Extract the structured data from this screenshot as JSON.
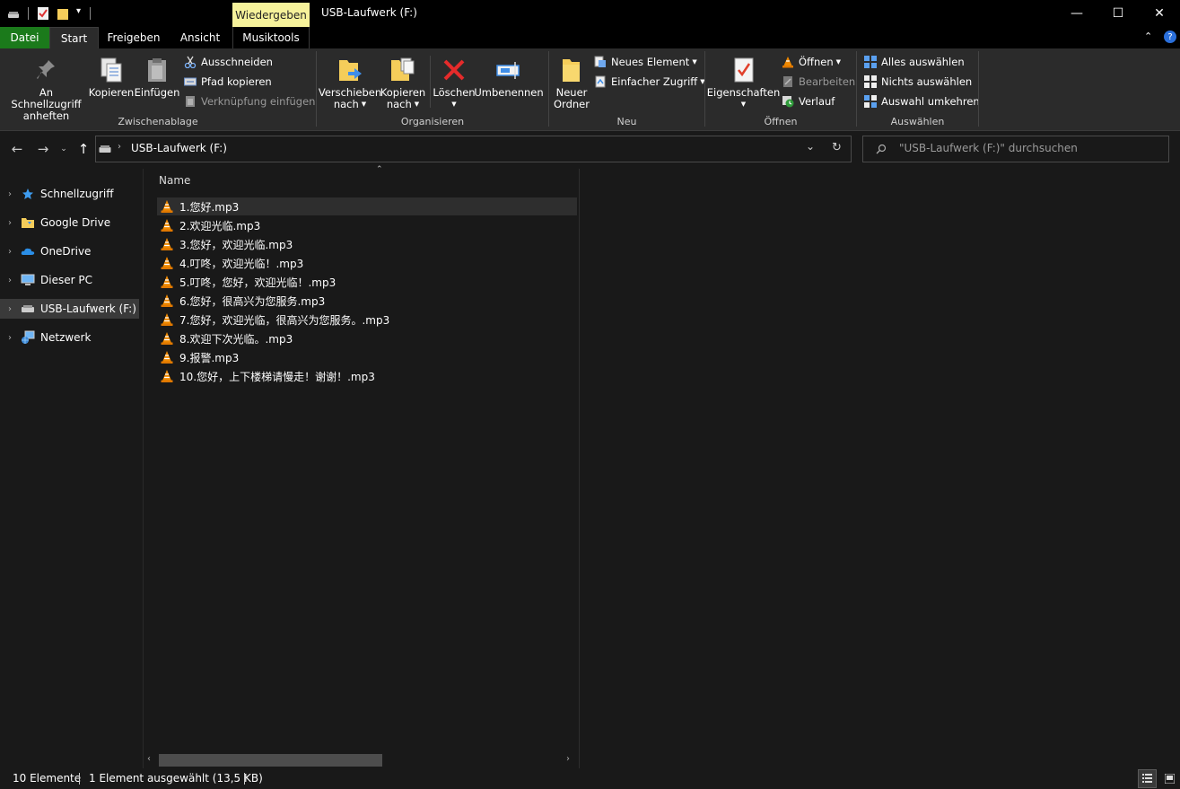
{
  "window": {
    "title": "USB-Laufwerk (F:)",
    "context_tab": "Wiedergeben",
    "minimize": "—",
    "maximize": "☐",
    "close": "✕"
  },
  "tabs": {
    "datei": "Datei",
    "start": "Start",
    "freigeben": "Freigeben",
    "ansicht": "Ansicht",
    "musiktools": "Musiktools"
  },
  "ribbon": {
    "clipboard": {
      "label": "Zwischenablage",
      "pin_line1": "An Schnellzugriff",
      "pin_line2": "anheften",
      "copy": "Kopieren",
      "paste": "Einfügen",
      "cut": "Ausschneiden",
      "copy_path": "Pfad kopieren",
      "paste_shortcut": "Verknüpfung einfügen"
    },
    "organize": {
      "label": "Organisieren",
      "move_line1": "Verschieben",
      "move_line2": "nach",
      "copyto_line1": "Kopieren",
      "copyto_line2": "nach",
      "delete": "Löschen",
      "rename": "Umbenennen"
    },
    "new": {
      "label": "Neu",
      "folder_line1": "Neuer",
      "folder_line2": "Ordner",
      "new_item": "Neues Element",
      "easy_access": "Einfacher Zugriff"
    },
    "open": {
      "label": "Öffnen",
      "properties": "Eigenschaften",
      "open": "Öffnen",
      "edit": "Bearbeiten",
      "history": "Verlauf"
    },
    "select": {
      "label": "Auswählen",
      "select_all": "Alles auswählen",
      "select_none": "Nichts auswählen",
      "invert": "Auswahl umkehren"
    }
  },
  "address": {
    "path": "USB-Laufwerk (F:)",
    "search_placeholder": "\"USB-Laufwerk (F:)\" durchsuchen"
  },
  "nav": {
    "items": [
      {
        "label": "Schnellzugriff"
      },
      {
        "label": "Google Drive"
      },
      {
        "label": "OneDrive"
      },
      {
        "label": "Dieser PC"
      },
      {
        "label": "USB-Laufwerk (F:)"
      },
      {
        "label": "Netzwerk"
      }
    ]
  },
  "files": {
    "column_name": "Name",
    "items": [
      {
        "name": "1.您好.mp3"
      },
      {
        "name": "2.欢迎光临.mp3"
      },
      {
        "name": "3.您好，欢迎光临.mp3"
      },
      {
        "name": "4.叮咚，欢迎光临！.mp3"
      },
      {
        "name": "5.叮咚，您好，欢迎光临！.mp3"
      },
      {
        "name": "6.您好，很高兴为您服务.mp3"
      },
      {
        "name": "7.您好，欢迎光临，很高兴为您服务。.mp3"
      },
      {
        "name": "8.欢迎下次光临。.mp3"
      },
      {
        "name": "9.报警.mp3"
      },
      {
        "name": "10.您好，上下楼梯请慢走！谢谢！.mp3"
      }
    ]
  },
  "status": {
    "count": "10 Elemente",
    "selection": "1 Element ausgewählt (13,5 KB)"
  },
  "colors": {
    "accent_green": "#1b7a1b",
    "context_yellow": "#f6f29b",
    "background": "#191919",
    "ribbon": "#2b2b2b"
  }
}
